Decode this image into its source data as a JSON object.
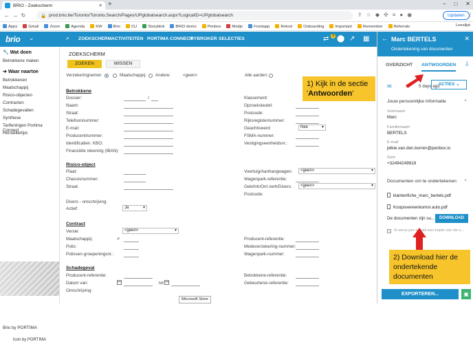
{
  "browser": {
    "tab_title": "BRIO - Zoekscherm",
    "url": "prod.brio.be/Toronto/Toronto.Search/Pages/UPglobalsearch.aspx?LogicalID=UPglobalsearch",
    "update_label": "Updaten",
    "bookmarks": [
      "Apps",
      "Gmail",
      "Zoom",
      "Agenda",
      "KW",
      "Brio",
      "CU",
      "Storyblok",
      "BRIO demo",
      "Penbox",
      "Modjo",
      "Frontapp",
      "Retool",
      "Onboarding",
      "Important",
      "Remember",
      "Referrals"
    ],
    "reading_list": "Leeslijst"
  },
  "app": {
    "logo": "brio",
    "nav": [
      "ZOEKSCHERM",
      "ACTIVITEITEN",
      "PORTIMA CONNECT",
      "MYBROKER",
      "SELECTIES"
    ],
    "badge_count": "3"
  },
  "sidebar": {
    "wat_doen": "Wat doen",
    "wat_doen_items": [
      "Betrokkene maken"
    ],
    "waar_naartoe": "Waar naartoe",
    "waar_items": [
      "Betrokkenen",
      "Maatschappij",
      "Risico-objecten",
      "Contracten",
      "Schadegevallen",
      "Synthese",
      "Tarifeningen Portima Connect",
      "Herstellerlijst"
    ],
    "footer_caption": "Brio by PORTIMA",
    "footer": "Icon by PORTIMA"
  },
  "search": {
    "title": "ZOEKSCHERM",
    "btn_search": "ZOEKEN",
    "btn_clear": "WISSEN",
    "radio_labels": [
      "Verzekeringnemer:",
      "Maatschappij:",
      "Andere:",
      "Alle aarden:"
    ],
    "andere_value": "<geen>",
    "sections": {
      "betrokkene": {
        "title": "Betrokkene",
        "left": [
          "Dossier:",
          "Naam:",
          "Straat:",
          "Telefoonnummer:",
          "E-mail:",
          "Producentnummer:",
          "Identificatien. KBO:",
          "Financiële rekening (IBAN):"
        ],
        "right": [
          "Klassement:",
          "Opzoeksleutel:",
          "Postcode:",
          "Rijksregisternummer:",
          "Geachtiveerd:",
          "FSMA-nummer:",
          "Vestigingseenheidsnr.:"
        ],
        "dossier_sep": "/",
        "geachtiveerd_value": "Nee"
      },
      "risico": {
        "title": "Risico-object",
        "left": [
          "Plaat:",
          "Chassisnummer:",
          "Straat:",
          "Divers - omschrijving:",
          "Actief:"
        ],
        "right": [
          "Voertuig/Aanhangwagen:",
          "Wagenpark-referentie:",
          "Geb/Inh/Ont verh/Divers:",
          "Postcode:"
        ],
        "voertuig_value": "<geen>",
        "geb_value": "<geen>",
        "actief_value": "Ja"
      },
      "contract": {
        "title": "Contract",
        "left": [
          "Versie:",
          "Maatschappij:",
          "Polis:",
          "Polissen-groepeningsnr.:"
        ],
        "right": [
          "Producent-referentie:",
          "Medeverzekering-nummer:",
          "Wagenpark-nummer:"
        ],
        "versie_value": "<geen>"
      },
      "schadegeval": {
        "title": "Schadegeval",
        "left": [
          "Producent-referentie:",
          "Datum van:",
          "Omschrijving:"
        ],
        "right": [
          "Betrokkene-referentie:",
          "Gebeurtenis-referentie:"
        ],
        "tot_label": "tot"
      }
    }
  },
  "panel": {
    "name": "Marc BERTELS",
    "subtitle": "Ondertekening van documenten",
    "tabs": [
      "OVERZICHT",
      "ANTWOORDEN"
    ],
    "ago": "5 days ago",
    "acties": "ACTIES",
    "info_title": "Jouw persoonlijke informatie",
    "fields": [
      {
        "label": "Voornaam",
        "value": "Marc"
      },
      {
        "label": "Familienaam",
        "value": "BERTELS"
      },
      {
        "label": "E-mail",
        "value": "jelkie.van.den.borren@penbox.io"
      },
      {
        "label": "Gsm",
        "value": "+32494249919"
      }
    ],
    "docs_title": "Documenten om te ondertekenen",
    "docs": [
      "klantenfiche_marc_bertels.pdf",
      "Koopovereenkomst auto.pdf"
    ],
    "docs_note": "De documenten zijn su...",
    "download_label": "DOWNLOAD",
    "checkbox_label": "Ik wens per e-mail een kopie van de o...",
    "export_label": "EXPORTEREN..."
  },
  "annotations": {
    "callout1_pre": "1) Kijk in de sectie '",
    "callout1_bold": "Antwoorden",
    "callout1_post": "'",
    "callout2": "2) Download hier de ondertekende documenten",
    "accent": "#f7c52b",
    "arrow_color": "#e02020"
  },
  "taskbar_tooltip": "Microsoft Store"
}
